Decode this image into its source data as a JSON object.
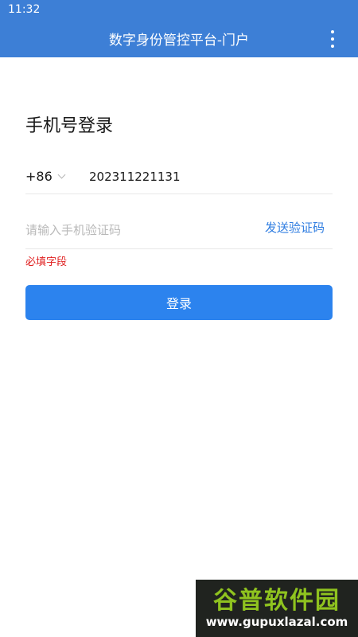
{
  "status_bar": {
    "time": "11:32"
  },
  "app_bar": {
    "title": "数字身份管控平台-门户",
    "menu_icon": "more-vertical-icon"
  },
  "login": {
    "title": "手机号登录",
    "country_code": "+86",
    "phone_value": "202311221131",
    "code_placeholder": "请输入手机验证码",
    "send_code_label": "发送验证码",
    "error_message": "必填字段",
    "submit_label": "登录"
  },
  "watermark": {
    "logo_text": "谷普软件园",
    "url": "www.gupuxlazal.com"
  },
  "colors": {
    "header": "#3d7fd6",
    "accent": "#2c83ee",
    "link": "#2f7de1",
    "error": "#e02020"
  }
}
